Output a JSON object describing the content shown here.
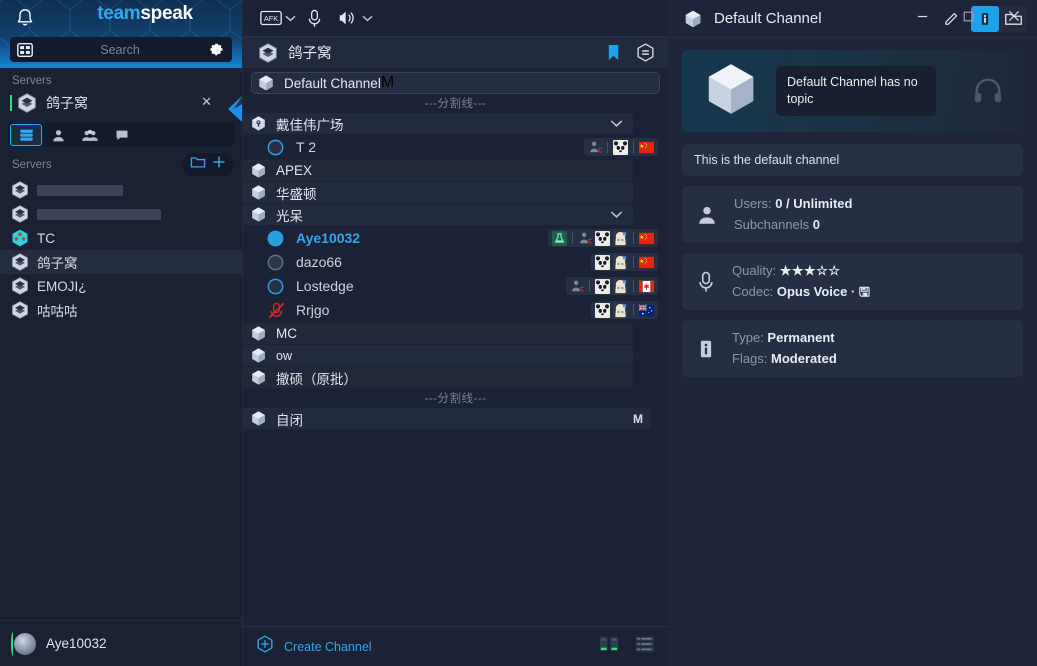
{
  "window": {
    "minimize_label": "minimize",
    "maximize_label": "maximize",
    "close_label": "close"
  },
  "brand": {
    "part1": "team",
    "part2": "speak",
    "bell_icon": "bell-icon"
  },
  "search": {
    "placeholder": "Search",
    "value": "",
    "layout_icon": "layout-grid-icon",
    "gear_icon": "gear-icon"
  },
  "sidebar": {
    "servers_label": "Servers",
    "current_server": "鸽子窝",
    "close_icon": "close-icon",
    "tabs": [
      {
        "name": "servers",
        "icon": "server-list-icon",
        "active": true
      },
      {
        "name": "contacts",
        "icon": "person-icon",
        "active": false
      },
      {
        "name": "groups",
        "icon": "group-icon",
        "active": false
      },
      {
        "name": "chats",
        "icon": "chat-bubble-icon",
        "active": false
      }
    ],
    "list_header": "Servers",
    "folder_icon": "folder-icon",
    "add_icon": "plus-icon",
    "items": [
      {
        "label": "",
        "redacted": true,
        "icon": "server-icon",
        "selected": false
      },
      {
        "label": "",
        "redacted": true,
        "icon": "server-icon",
        "selected": false
      },
      {
        "label": "TC",
        "redacted": false,
        "icon": "server-icon-colored",
        "selected": false
      },
      {
        "label": "鸽子窝",
        "redacted": false,
        "icon": "server-icon",
        "selected": true
      },
      {
        "label": "EMOJI¿",
        "redacted": false,
        "icon": "server-icon",
        "selected": false
      },
      {
        "label": "咕咕咕",
        "redacted": false,
        "icon": "server-icon",
        "selected": false
      }
    ],
    "footer_user": "Aye10032",
    "footer_avatar": "avatar"
  },
  "channel_toolbar": {
    "afk_label": "AFK",
    "afk_icon": "afk-icon",
    "mic_icon": "microphone-icon",
    "speaker_icon": "speaker-icon",
    "chevron_icon": "chevron-down-icon"
  },
  "server_banner": {
    "name": "鸽子窝",
    "server_icon": "server-icon",
    "bookmark_icon": "bookmark-icon",
    "server_info_icon": "server-info-icon"
  },
  "tree": [
    {
      "kind": "channel",
      "label": "Default Channel",
      "icon": "channel-cube-icon",
      "flag": "M",
      "selected": true,
      "indent": 0
    },
    {
      "kind": "divider",
      "label": "---分割线---"
    },
    {
      "kind": "channel",
      "label": "戴佳伟广场",
      "icon": "channel-pin-icon",
      "flag": "",
      "expandable": true,
      "indent": 0
    },
    {
      "kind": "user",
      "label": "T 2",
      "status": "away",
      "badges": [
        "client-c-icon",
        "sep",
        "panda-avatar",
        "sep",
        "flag-cn"
      ]
    },
    {
      "kind": "channel",
      "label": "APEX",
      "icon": "channel-cube-icon",
      "flag": "",
      "indent": 0
    },
    {
      "kind": "channel",
      "label": "华盛顿",
      "icon": "channel-cube-icon",
      "flag": "",
      "indent": 0
    },
    {
      "kind": "channel",
      "label": "光呆",
      "icon": "channel-cube-icon",
      "flag": "",
      "expandable": true,
      "indent": 0
    },
    {
      "kind": "user",
      "label": "Aye10032",
      "status": "talking",
      "me": true,
      "badges": [
        "flask-icon",
        "sep",
        "client-c-icon",
        "sep",
        "panda-avatar",
        "anime-avatar",
        "sep",
        "flag-cn"
      ]
    },
    {
      "kind": "user",
      "label": "dazo66",
      "status": "idle",
      "badges": [
        "panda-avatar",
        "anime-avatar",
        "sep",
        "flag-cn"
      ]
    },
    {
      "kind": "user",
      "label": "Lostedge",
      "status": "away",
      "badges": [
        "client-c-icon",
        "sep",
        "panda-avatar",
        "anime-avatar",
        "sep",
        "flag-ca"
      ]
    },
    {
      "kind": "user",
      "label": "Rrjgo",
      "status": "muted",
      "badges": [
        "panda-avatar",
        "anime-avatar",
        "sep",
        "flag-au"
      ]
    },
    {
      "kind": "channel",
      "label": "MC",
      "icon": "channel-cube-icon",
      "flag": "",
      "indent": 0
    },
    {
      "kind": "channel",
      "label": "ow",
      "icon": "channel-cube-icon",
      "flag": "",
      "indent": 0
    },
    {
      "kind": "channel",
      "label": "撤硕（原批）",
      "icon": "channel-cube-icon",
      "flag": "",
      "indent": 0
    },
    {
      "kind": "divider",
      "label": "---分割线---"
    },
    {
      "kind": "channel",
      "label": "自闭",
      "icon": "channel-cube-icon",
      "flag": "M",
      "indent": 0
    }
  ],
  "channel_footer": {
    "create_label": "Create Channel",
    "plus_icon": "plus-hexagon-icon",
    "view_icon_1": "column-view-icon",
    "view_icon_2": "list-view-icon"
  },
  "info_panel": {
    "title": "Default Channel",
    "channel_icon": "channel-cube-icon",
    "edit_icon": "pencil-icon",
    "info_icon": "info-icon",
    "files_icon": "folder-files-icon",
    "topic_text": "Default Channel has no topic",
    "headphone_icon": "headphone-icon",
    "description": "This is the default channel",
    "cards": [
      {
        "icon": "person-icon",
        "line1_key": "Users:",
        "line1_val": "0 / Unlimited",
        "line2_key": "Subchannels",
        "line2_val": "0"
      },
      {
        "icon": "microphone-icon",
        "line1_key": "Quality:",
        "line1_val": "★★★☆☆",
        "line2_key": "Codec:",
        "line2_val": "Opus Voice · 🖫"
      },
      {
        "icon": "info-icon",
        "line1_key": "Type:",
        "line1_val": "Permanent",
        "line2_key": "Flags:",
        "line2_val": "Moderated"
      }
    ]
  },
  "colors": {
    "accent": "#2fa8f0",
    "bg_dark": "#1b2235",
    "panel": "#1e2538",
    "card": "#262e42",
    "green": "#2fe07a"
  }
}
